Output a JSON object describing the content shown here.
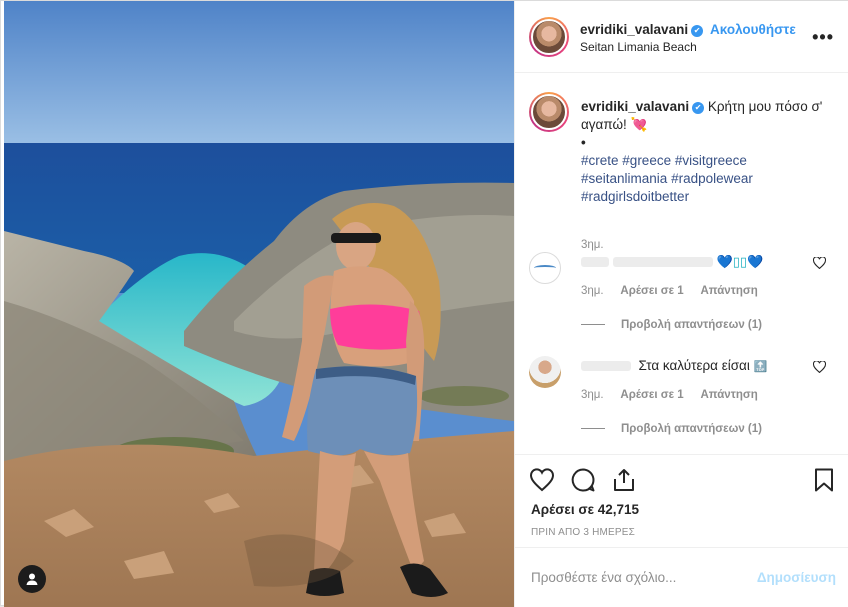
{
  "post": {
    "username": "evridiki_valavani",
    "verified_mark": "✔",
    "follow_label": "Ακολουθήστε",
    "location": "Seitan Limania Beach",
    "more_label": "•••"
  },
  "caption": {
    "username": "evridiki_valavani",
    "text": "Κρήτη μου πόσο σ' αγαπώ! 💘",
    "dot": "•",
    "hashtags": [
      "#crete",
      "#greece",
      "#visitgreece",
      "#seitanlimania",
      "#radpolewear",
      "#radgirlsdoitbetter"
    ],
    "time": "3ημ."
  },
  "comments": [
    {
      "text": "",
      "emoji": "💙▯▯💙",
      "time": "3ημ.",
      "likes_label": "Αρέσει σε 1",
      "reply_label": "Απάντηση",
      "view_replies": "Προβολή απαντήσεων (1)"
    },
    {
      "text": "Στα καλύτερα είσαι",
      "emoji": "🔝",
      "time": "3ημ.",
      "likes_label": "Αρέσει σε 1",
      "reply_label": "Απάντηση",
      "view_replies": "Προβολή απαντήσεων (1)"
    }
  ],
  "actions": {
    "likes_text": "Αρέσει σε 42,715",
    "posted_text": "ΠΡΙΝ ΑΠΟ 3 ΗΜΕΡΕΣ",
    "icons": [
      "heart-icon",
      "comment-icon",
      "share-icon",
      "bookmark-icon"
    ]
  },
  "add_comment": {
    "placeholder": "Προσθέστε ένα σχόλιο...",
    "post_label": "Δημοσίευση"
  },
  "colors": {
    "accent": "#3897f0",
    "link": "#385185",
    "muted": "#8e8e8e",
    "post_disabled": "#b2dffc"
  }
}
